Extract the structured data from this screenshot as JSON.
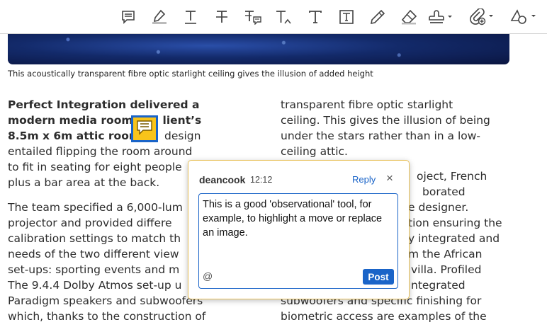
{
  "toolbar": {
    "tools": [
      {
        "name": "comment-tool",
        "icon": "comment-icon"
      },
      {
        "name": "highlight-tool",
        "icon": "highlighter-icon"
      },
      {
        "name": "underline-tool",
        "icon": "underline-text-icon"
      },
      {
        "name": "strikethrough-tool",
        "icon": "strikethrough-text-icon"
      },
      {
        "name": "replace-text-tool",
        "icon": "replace-text-icon"
      },
      {
        "name": "insert-text-tool",
        "icon": "insert-text-icon"
      },
      {
        "name": "add-text-tool",
        "icon": "text-icon"
      },
      {
        "name": "text-box-tool",
        "icon": "text-box-icon"
      },
      {
        "name": "draw-tool",
        "icon": "pencil-icon"
      },
      {
        "name": "eraser-tool",
        "icon": "eraser-icon"
      },
      {
        "name": "stamp-tool",
        "icon": "stamp-icon"
      },
      {
        "name": "attach-tool",
        "icon": "attach-icon"
      },
      {
        "name": "shapes-tool",
        "icon": "shapes-icon"
      }
    ],
    "accent_color": "#1a64c8"
  },
  "document": {
    "caption": "This acoustically transparent fibre optic starlight ceiling gives the illusion of added height",
    "left_column": {
      "lead_lines": [
        "Perfect Integration delivered a",
        "modern media room. The client’s",
        "8.5m x 6m attic room’s design"
      ],
      "lead_lines_visible": [
        "Perfect Integration delivered a",
        "modern media room",
        "lient’s",
        "8.5m x 6m attic room",
        "design"
      ],
      "body1_lines": [
        "entailed flipping the room around",
        "to fit in seating for eight people",
        "plus a bar area at the back."
      ],
      "body2_lines": [
        "The team specified a 6,000-lum",
        "projector and provided differe",
        "calibration settings to match th",
        "needs of the two different view",
        "set-ups: sporting events and m",
        "The 9.4.4 Dolby Atmos set-up u",
        "Paradigm speakers and subwoofers",
        "which, thanks to the construction of"
      ]
    },
    "right_column": {
      "para1_lines": [
        "transparent fibre optic starlight",
        "ceiling. This gives the illusion of being",
        "under the stars rather than in a low-",
        "ceiling attic."
      ],
      "para2_lines": [
        "oject, French",
        "borated",
        "e designer.",
        "tion ensuring the",
        "y integrated and",
        "m the African",
        "villa. Profiled",
        "ntegrated",
        "subwoofers and specific finishing for",
        "biometric access are examples of the"
      ]
    }
  },
  "comment_popup": {
    "author": "deancook",
    "time": "12:12",
    "reply_label": "Reply",
    "close_label": "×",
    "text": "This is a good 'observational' tool, for example, to highlight a move or replace an image.",
    "mention_label": "@",
    "post_label": "Post",
    "border_color": "#e8c15a",
    "marker_color": "#f9c41a"
  }
}
